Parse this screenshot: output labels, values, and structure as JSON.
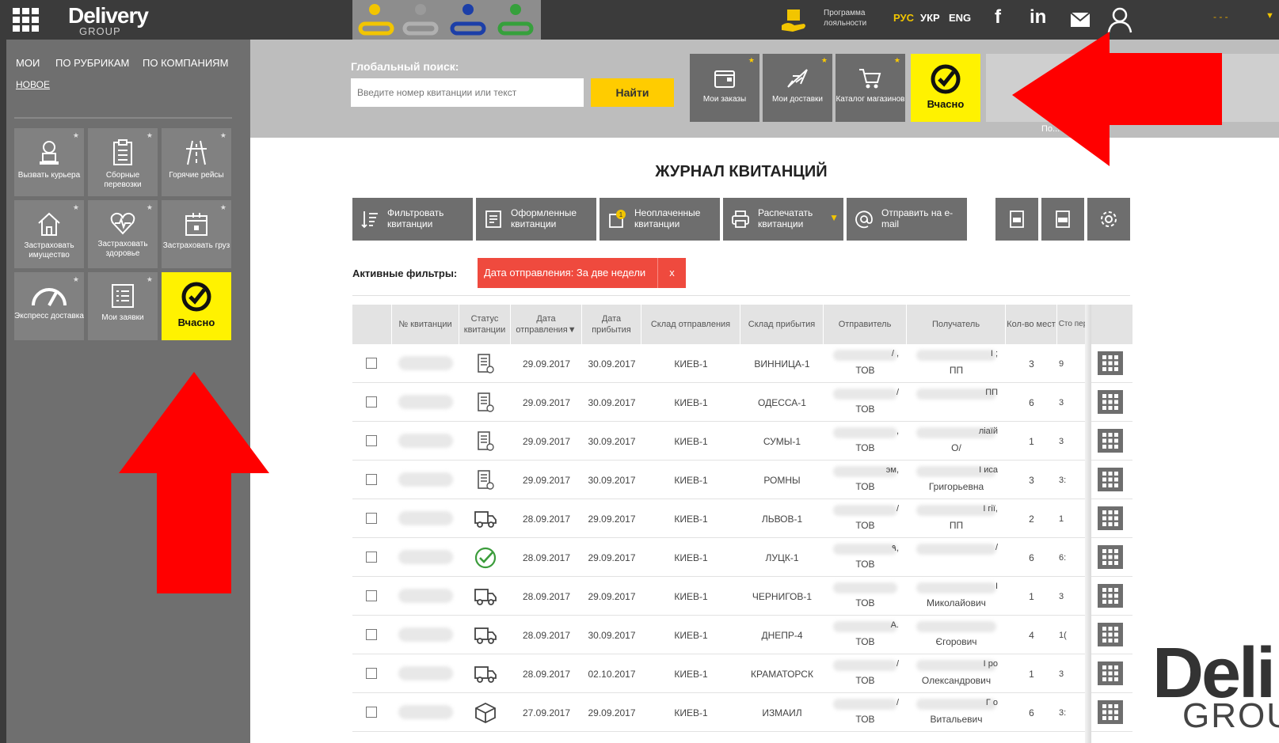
{
  "brand": {
    "logo": "Delivery",
    "logo_sub": "GROUP",
    "watermark_main": "Deli",
    "watermark_sub": "GROU"
  },
  "topbar": {
    "loyalty": "Программа лояльности",
    "languages": [
      "РУС",
      "УКР",
      "ENG"
    ],
    "active_language": "РУС",
    "social": [
      "f",
      "in"
    ],
    "user_name": "- - -"
  },
  "sidebar": {
    "nav": [
      "МОИ",
      "ПО РУБРИКАМ",
      "ПО КОМПАНИЯМ",
      "НОВОЕ"
    ],
    "tiles": [
      {
        "label": "Вызвать курьера",
        "icon": "courier-icon"
      },
      {
        "label": "Сборные перевозки",
        "icon": "clipboard-icon"
      },
      {
        "label": "Горячие рейсы",
        "icon": "road-icon"
      },
      {
        "label": "Застраховать имущество",
        "icon": "house-icon"
      },
      {
        "label": "Застраховать здоровье",
        "icon": "heart-icon"
      },
      {
        "label": "Застраховать груз",
        "icon": "cargo-icon"
      },
      {
        "label": "Экспресс доставка",
        "icon": "speedometer-icon"
      },
      {
        "label": "Мои заявки",
        "icon": "list-icon"
      },
      {
        "label": "Вчасно",
        "icon": "vchasno-check-icon"
      }
    ]
  },
  "header": {
    "search_label": "Глобальный поиск:",
    "search_placeholder": "Введите номер квитанции или текст",
    "search_button": "Найти",
    "quick_buttons": [
      {
        "label": "Мои заказы",
        "icon": "wallet-icon"
      },
      {
        "label": "Мои доставки",
        "icon": "plane-icon"
      },
      {
        "label": "Каталог магазинов",
        "icon": "cart-icon"
      },
      {
        "label": "Вчасно",
        "icon": "vchasno-check-icon"
      }
    ],
    "note": "По...    ...ше?"
  },
  "journal": {
    "title": "ЖУРНАЛ КВИТАНЦИЙ",
    "toolbar": [
      {
        "label": "Фильтровать квитанции",
        "icon": "filter-sort-icon"
      },
      {
        "label": "Оформленные квитанции",
        "icon": "document-icon"
      },
      {
        "label": "Неоплаченные квитанции",
        "icon": "unpaid-icon"
      },
      {
        "label": "Распечатать квитанции",
        "icon": "printer-icon"
      },
      {
        "label": "Отправить на e-mail",
        "icon": "at-icon"
      }
    ],
    "export_buttons": [
      "pdf-export-icon",
      "xlsx-export-icon",
      "settings-gear-icon"
    ],
    "active_filters_label": "Активные фильтры:",
    "active_filter": "Дата отправления: За две недели",
    "active_filter_remove": "x",
    "columns": [
      "№ квитанции",
      "Статус квитанции",
      "Дата отправления▼",
      "Дата прибытия",
      "Склад отправления",
      "Склад прибытия",
      "Отправитель",
      "Получатель",
      "Кол-во мест",
      "Сто пер"
    ],
    "rows": [
      {
        "status": "document-status-icon",
        "sent": "29.09.2017",
        "arrived": "30.09.2017",
        "from": "КИЕВ-1",
        "to": "ВИННИЦА-1",
        "sender_a": "/ ,",
        "sender_b": "ТОВ",
        "recipient_a": "I ;",
        "recipient_b": "ПП",
        "places": "3",
        "cost": "9"
      },
      {
        "status": "document-status-icon",
        "sent": "29.09.2017",
        "arrived": "30.09.2017",
        "from": "КИЕВ-1",
        "to": "ОДЕССА-1",
        "sender_a": "/",
        "sender_b": "ТОВ",
        "recipient_a": "ПП",
        "recipient_b": "",
        "places": "6",
        "cost": "3"
      },
      {
        "status": "document-status-icon",
        "sent": "29.09.2017",
        "arrived": "30.09.2017",
        "from": "КИЕВ-1",
        "to": "СУМЫ-1",
        "sender_a": ",",
        "sender_b": "ТОВ",
        "recipient_a": "ліаїй",
        "recipient_b": "О/",
        "places": "1",
        "cost": "3"
      },
      {
        "status": "document-status-icon",
        "sent": "29.09.2017",
        "arrived": "30.09.2017",
        "from": "КИЕВ-1",
        "to": "РОМНЫ",
        "sender_a": "эм,",
        "sender_b": "ТОВ",
        "recipient_a": "I иса",
        "recipient_b": "Григорьевна",
        "places": "3",
        "cost": "3:"
      },
      {
        "status": "truck-status-icon",
        "sent": "28.09.2017",
        "arrived": "29.09.2017",
        "from": "КИЕВ-1",
        "to": "ЛЬВОВ-1",
        "sender_a": "/",
        "sender_b": "ТОВ",
        "recipient_a": "I гії,",
        "recipient_b": "ПП",
        "places": "2",
        "cost": "1"
      },
      {
        "status": "delivered-check-icon",
        "sent": "28.09.2017",
        "arrived": "29.09.2017",
        "from": "КИЕВ-1",
        "to": "ЛУЦК-1",
        "sender_a": "٩,",
        "sender_b": "ТОВ",
        "recipient_a": "/",
        "recipient_b": "",
        "places": "6",
        "cost": "6:"
      },
      {
        "status": "truck-status-icon",
        "sent": "28.09.2017",
        "arrived": "29.09.2017",
        "from": "КИЕВ-1",
        "to": "ЧЕРНИГОВ-1",
        "sender_a": "",
        "sender_b": "ТОВ",
        "recipient_a": "I",
        "recipient_b": "Миколайович",
        "places": "1",
        "cost": "3"
      },
      {
        "status": "truck-status-icon",
        "sent": "28.09.2017",
        "arrived": "30.09.2017",
        "from": "КИЕВ-1",
        "to": "ДНЕПР-4",
        "sender_a": "A.",
        "sender_b": "ТОВ",
        "recipient_a": "",
        "recipient_b": "Єгорович",
        "places": "4",
        "cost": "1("
      },
      {
        "status": "truck-status-icon",
        "sent": "28.09.2017",
        "arrived": "02.10.2017",
        "from": "КИЕВ-1",
        "to": "КРАМАТОРСК",
        "sender_a": "/",
        "sender_b": "ТОВ",
        "recipient_a": "I ро",
        "recipient_b": "Олександрович",
        "places": "1",
        "cost": "3"
      },
      {
        "status": "box-status-icon",
        "sent": "27.09.2017",
        "arrived": "29.09.2017",
        "from": "КИЕВ-1",
        "to": "ИЗМАИЛ",
        "sender_a": "/",
        "sender_b": "ТОВ",
        "recipient_a": "Г о",
        "recipient_b": "Витальевич",
        "places": "6",
        "cost": "3:"
      }
    ]
  },
  "colors": {
    "accent_yellow": "#fff200",
    "button_yellow": "#ffcc00",
    "filter_red": "#ef4a3e",
    "arrow_red": "#ff0000",
    "sidebar_gray": "#6f6f6f"
  }
}
